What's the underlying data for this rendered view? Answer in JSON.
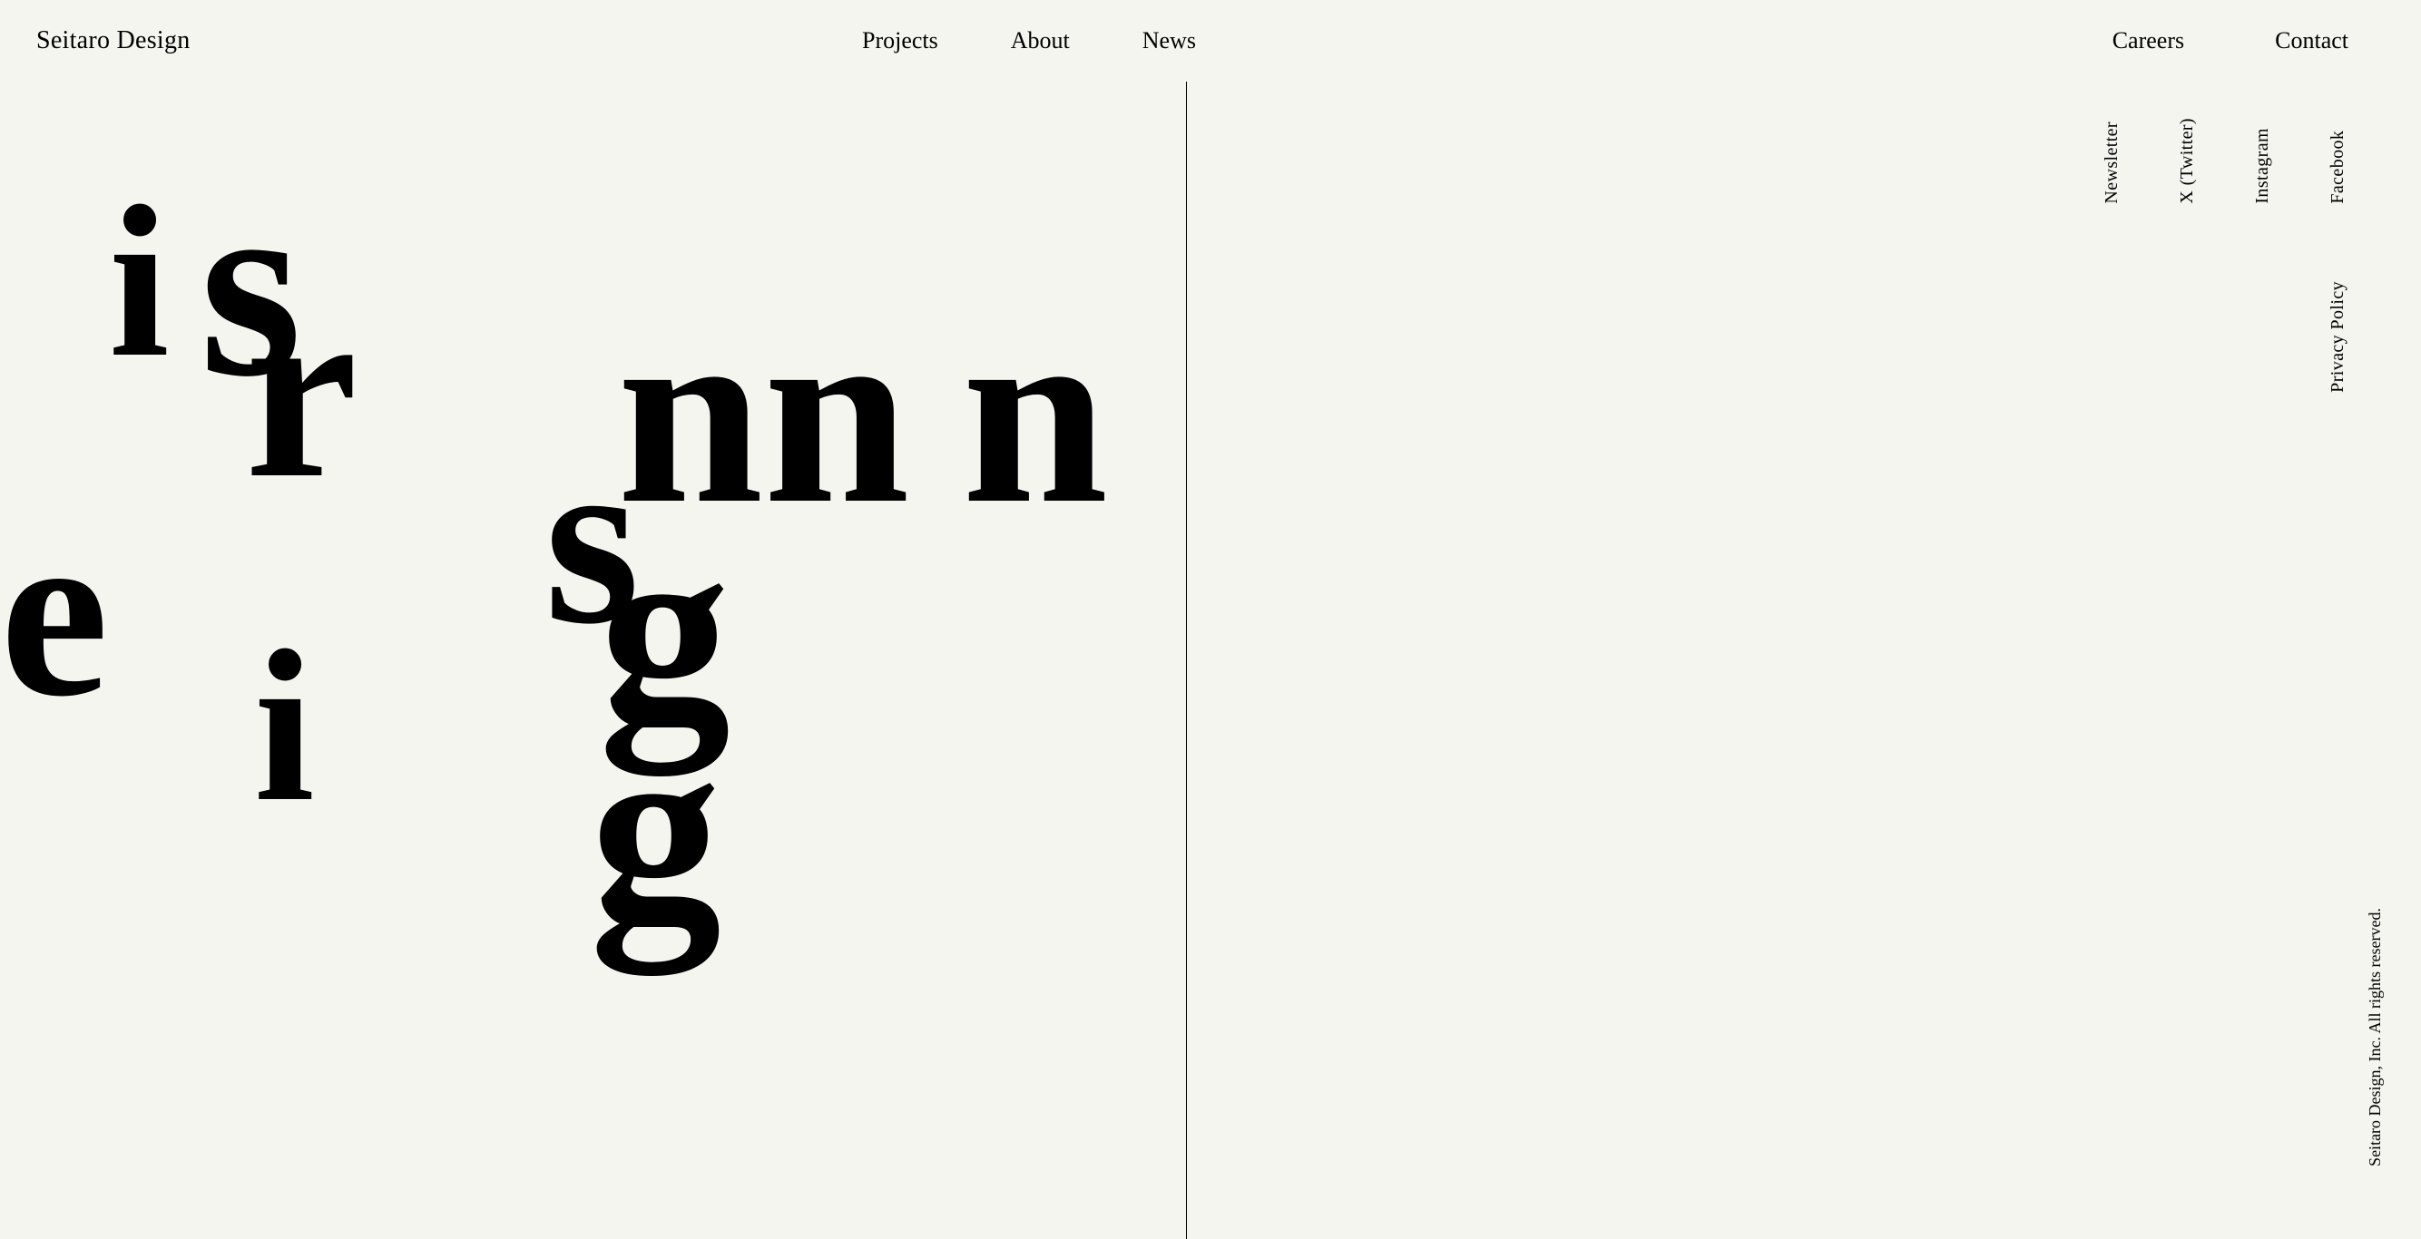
{
  "header": {
    "logo": "Seitaro Design",
    "nav_center": [
      {
        "label": "Projects",
        "href": "#"
      },
      {
        "label": "About",
        "href": "#"
      },
      {
        "label": "News",
        "href": "#"
      }
    ],
    "nav_right": [
      {
        "label": "Careers",
        "href": "#"
      },
      {
        "label": "Contact",
        "href": "#"
      }
    ]
  },
  "right_panel": {
    "social_links": [
      {
        "label": "Facebook",
        "href": "#"
      },
      {
        "label": "Instagram",
        "href": "#"
      },
      {
        "label": "X (Twitter)",
        "href": "#"
      },
      {
        "label": "Newsletter",
        "href": "#"
      }
    ],
    "policy_links": [
      {
        "label": "Privacy Policy",
        "href": "#"
      }
    ],
    "copyright": "Seitaro Design, Inc. All rights reserved."
  },
  "letters": [
    {
      "char": "i",
      "class": "letter-i-1"
    },
    {
      "char": "s",
      "class": "letter-s"
    },
    {
      "char": "r",
      "class": "letter-r"
    },
    {
      "char": "nn",
      "class": "letter-nn-1"
    },
    {
      "char": "n",
      "class": "letter-n"
    },
    {
      "char": "s",
      "class": "letter-ss"
    },
    {
      "char": "e",
      "class": "letter-e"
    },
    {
      "char": "g",
      "class": "letter-g-1"
    },
    {
      "char": "i",
      "class": "letter-i-2"
    },
    {
      "char": "g",
      "class": "letter-g-2"
    }
  ]
}
